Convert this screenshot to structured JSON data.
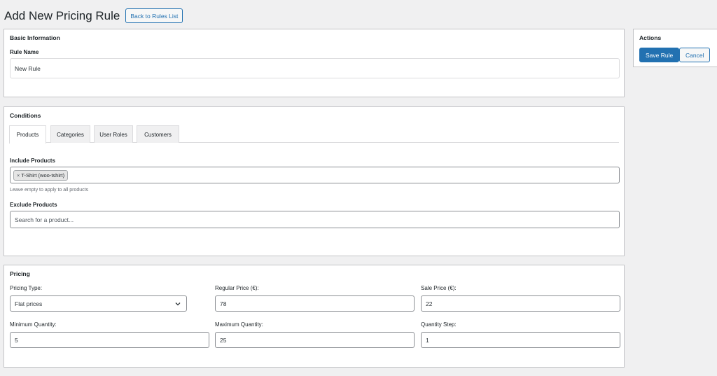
{
  "header": {
    "title": "Add New Pricing Rule",
    "back_label": "Back to Rules List"
  },
  "basic": {
    "title": "Basic Information",
    "rule_name_label": "Rule Name",
    "rule_name_value": "New Rule"
  },
  "conditions": {
    "title": "Conditions",
    "tabs": [
      {
        "label": "Products",
        "active": true
      },
      {
        "label": "Categories",
        "active": false
      },
      {
        "label": "User Roles",
        "active": false
      },
      {
        "label": "Customers",
        "active": false
      }
    ],
    "include_label": "Include Products",
    "include_chip": "T-Shirt (woo-tshirt)",
    "chip_remove_glyph": "×",
    "include_hint": "Leave empty to apply to all products",
    "exclude_label": "Exclude Products",
    "exclude_placeholder": "Search for a product..."
  },
  "pricing": {
    "title": "Pricing",
    "type_label": "Pricing Type:",
    "type_value": "Flat prices",
    "regular_label": "Regular Price (€):",
    "regular_value": "78",
    "sale_label": "Sale Price (€):",
    "sale_value": "22",
    "min_label": "Minimum Quantity:",
    "min_value": "5",
    "max_label": "Maximum Quantity:",
    "max_value": "25",
    "step_label": "Quantity Step:",
    "step_value": "1"
  },
  "actions": {
    "title": "Actions",
    "save_label": "Save Rule",
    "cancel_label": "Cancel"
  },
  "colors": {
    "accent": "#2271b1",
    "background": "#f0f0f1",
    "border": "#c3c4c7"
  }
}
